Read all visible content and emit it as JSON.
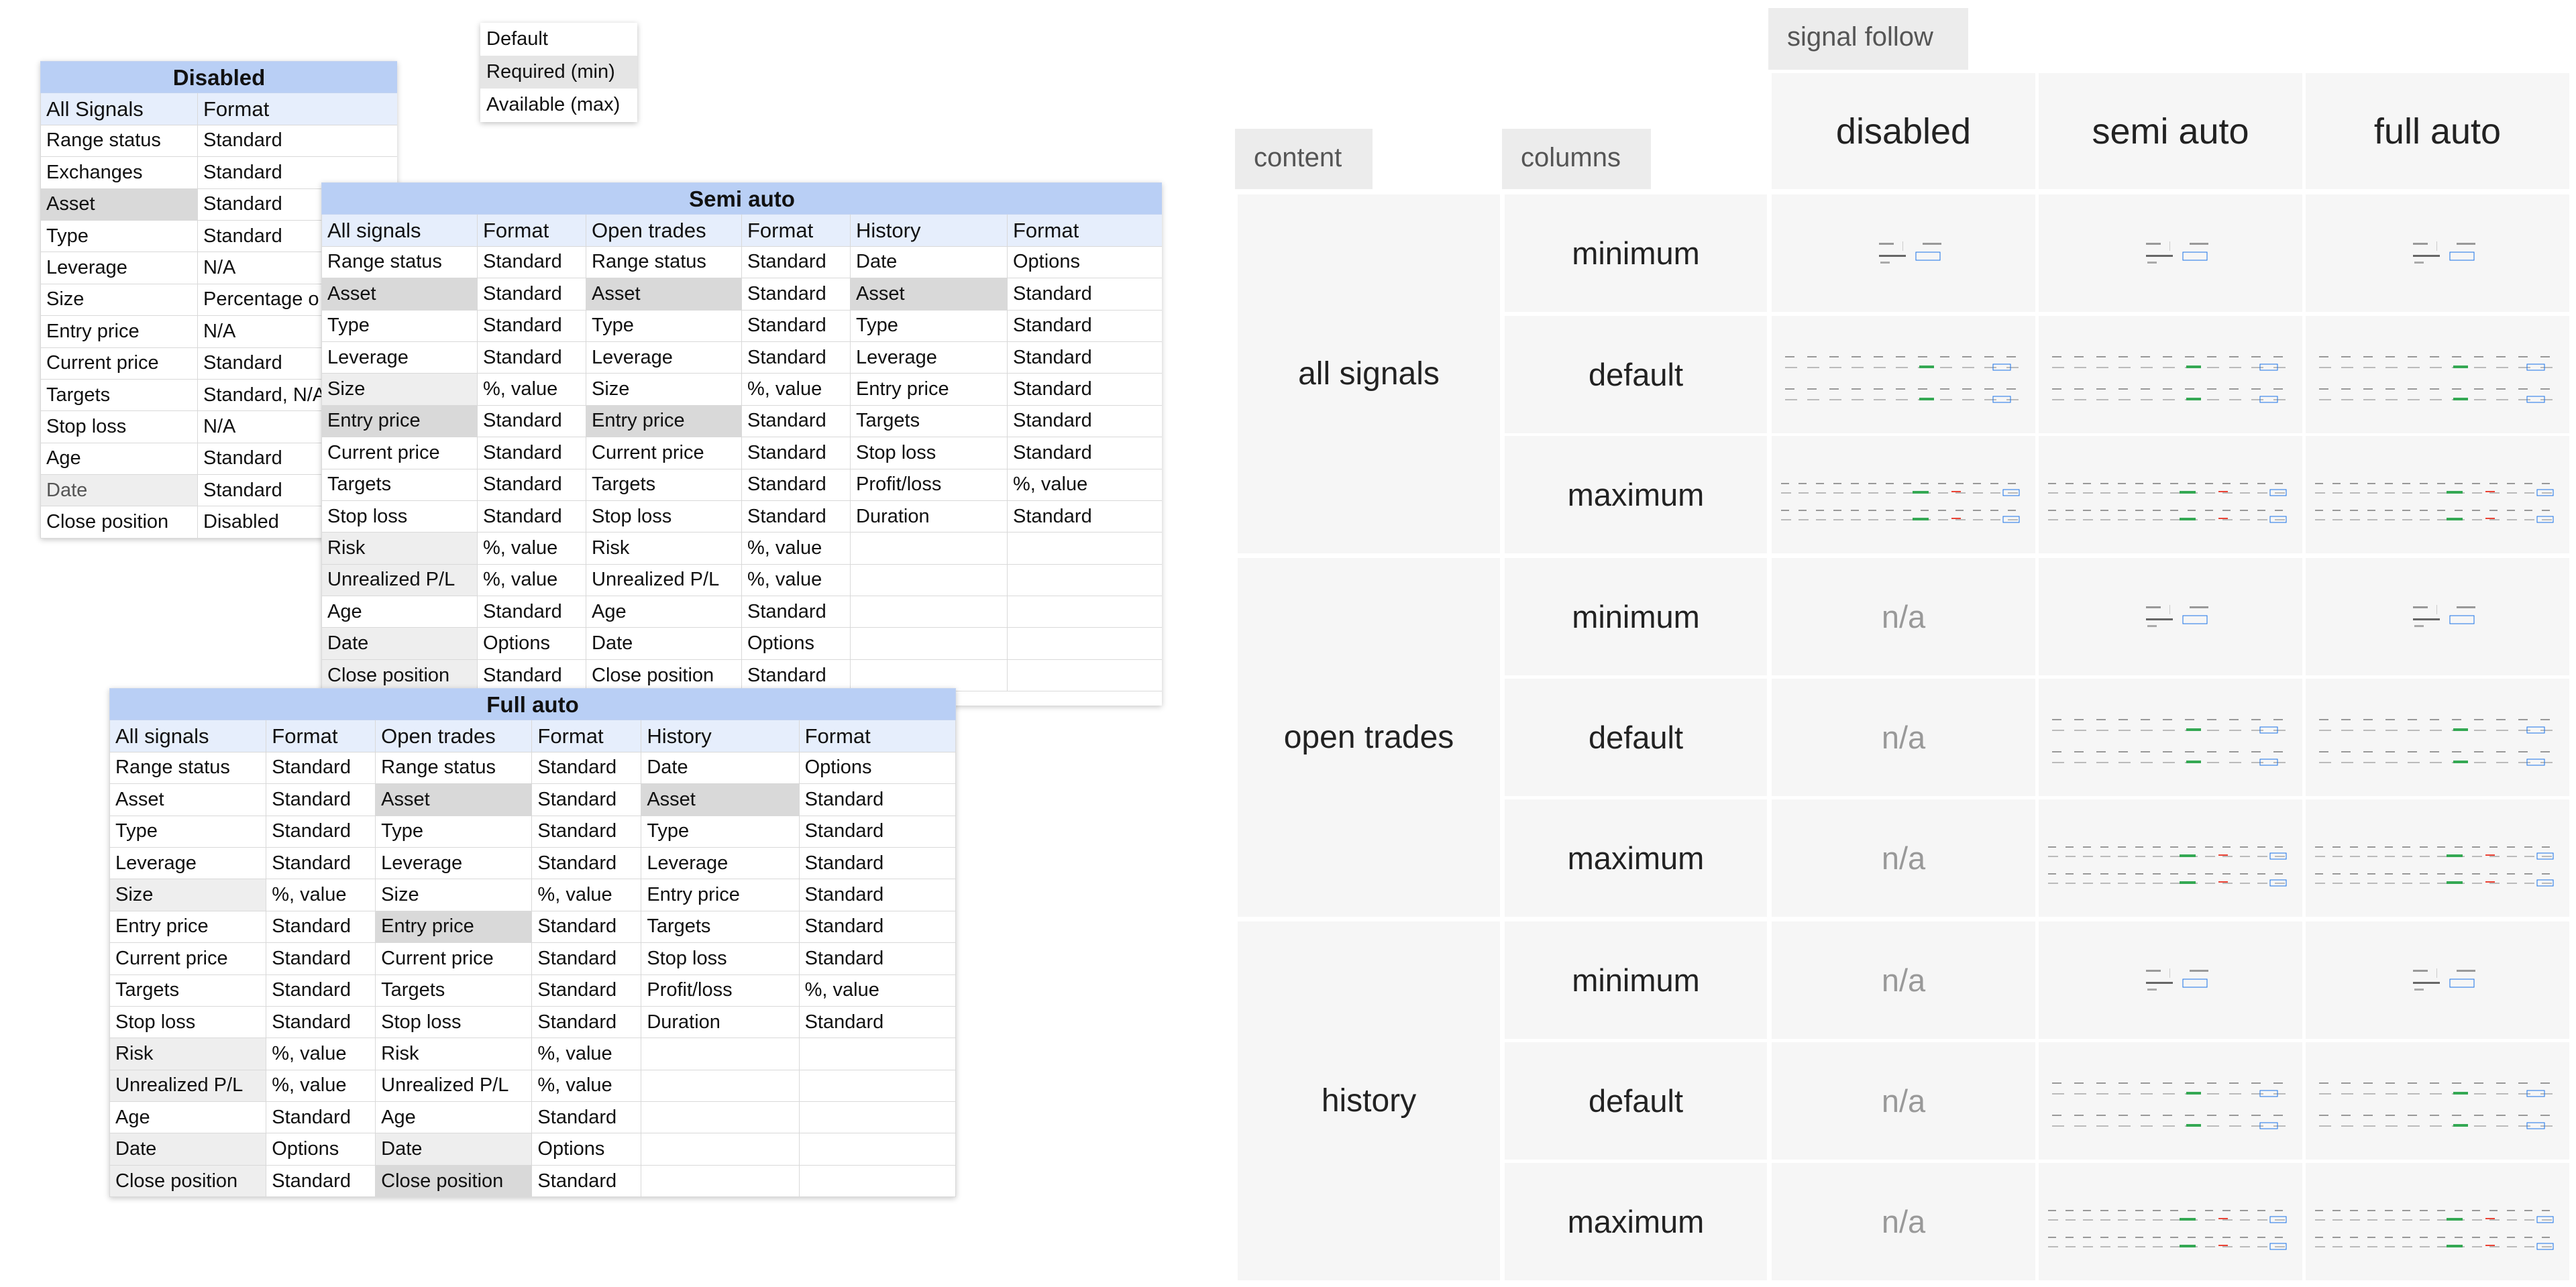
{
  "legend": {
    "items": [
      "Default",
      "Required (min)",
      "Available (max)"
    ]
  },
  "tables": {
    "disabled": {
      "title": "Disabled",
      "headers": [
        "All Signals",
        "Format"
      ],
      "rows": [
        [
          "Range status",
          "Standard"
        ],
        [
          "Exchanges",
          "Standard"
        ],
        [
          "Asset",
          "Standard"
        ],
        [
          "Type",
          "Standard"
        ],
        [
          "Leverage",
          "N/A"
        ],
        [
          "Size",
          "Percentage o"
        ],
        [
          "Entry price",
          "N/A"
        ],
        [
          "Current price",
          "Standard"
        ],
        [
          "Targets",
          "Standard, N/A"
        ],
        [
          "Stop loss",
          "N/A"
        ],
        [
          "Age",
          "Standard"
        ],
        [
          "Date",
          "Standard"
        ],
        [
          "Close position",
          "Disabled"
        ]
      ]
    },
    "semi": {
      "title": "Semi auto",
      "headers": [
        "All signals",
        "Format",
        "Open trades",
        "Format",
        "History",
        "Format"
      ],
      "rows": [
        [
          "Range status",
          "Standard",
          "Range status",
          "Standard",
          "Date",
          "Options"
        ],
        [
          "Asset",
          "Standard",
          "Asset",
          "Standard",
          "Asset",
          "Standard"
        ],
        [
          "Type",
          "Standard",
          "Type",
          "Standard",
          "Type",
          "Standard"
        ],
        [
          "Leverage",
          "Standard",
          "Leverage",
          "Standard",
          "Leverage",
          "Standard"
        ],
        [
          "Size",
          "%, value",
          "Size",
          "%, value",
          "Entry price",
          "Standard"
        ],
        [
          "Entry price",
          "Standard",
          "Entry price",
          "Standard",
          "Targets",
          "Standard"
        ],
        [
          "Current price",
          "Standard",
          "Current price",
          "Standard",
          "Stop loss",
          "Standard"
        ],
        [
          "Targets",
          "Standard",
          "Targets",
          "Standard",
          "Profit/loss",
          "%, value"
        ],
        [
          "Stop loss",
          "Standard",
          "Stop loss",
          "Standard",
          "Duration",
          "Standard"
        ],
        [
          "Risk",
          "%, value",
          "Risk",
          "%, value",
          "",
          ""
        ],
        [
          "Unrealized P/L",
          "%, value",
          "Unrealized P/L",
          "%, value",
          "",
          ""
        ],
        [
          "Age",
          "Standard",
          "Age",
          "Standard",
          "",
          ""
        ],
        [
          "Date",
          "Options",
          "Date",
          "Options",
          "",
          ""
        ],
        [
          "Close position",
          "Standard",
          "Close position",
          "Standard",
          "",
          ""
        ]
      ]
    },
    "full": {
      "title": "Full auto",
      "headers": [
        "All signals",
        "Format",
        "Open trades",
        "Format",
        "History",
        "Format"
      ],
      "rows": [
        [
          "Range status",
          "Standard",
          "Range status",
          "Standard",
          "Date",
          "Options"
        ],
        [
          "Asset",
          "Standard",
          "Asset",
          "Standard",
          "Asset",
          "Standard"
        ],
        [
          "Type",
          "Standard",
          "Type",
          "Standard",
          "Type",
          "Standard"
        ],
        [
          "Leverage",
          "Standard",
          "Leverage",
          "Standard",
          "Leverage",
          "Standard"
        ],
        [
          "Size",
          "%, value",
          "Size",
          "%, value",
          "Entry price",
          "Standard"
        ],
        [
          "Entry price",
          "Standard",
          "Entry price",
          "Standard",
          "Targets",
          "Standard"
        ],
        [
          "Current price",
          "Standard",
          "Current price",
          "Standard",
          "Stop loss",
          "Standard"
        ],
        [
          "Targets",
          "Standard",
          "Targets",
          "Standard",
          "Profit/loss",
          "%, value"
        ],
        [
          "Stop loss",
          "Standard",
          "Stop loss",
          "Standard",
          "Duration",
          "Standard"
        ],
        [
          "Risk",
          "%, value",
          "Risk",
          "%, value",
          "",
          ""
        ],
        [
          "Unrealized P/L",
          "%, value",
          "Unrealized P/L",
          "%, value",
          "",
          ""
        ],
        [
          "Age",
          "Standard",
          "Age",
          "Standard",
          "",
          ""
        ],
        [
          "Date",
          "Options",
          "Date",
          "Options",
          "",
          ""
        ],
        [
          "Close position",
          "Standard",
          "Close position",
          "Standard",
          "",
          ""
        ]
      ]
    }
  },
  "matrix": {
    "tab_signal_follow": "signal follow",
    "tab_content": "content",
    "tab_columns": "columns",
    "modes": [
      "disabled",
      "semi auto",
      "full auto"
    ],
    "groups": [
      {
        "label": "all signals",
        "rows": [
          {
            "column": "minimum",
            "cells": [
              "thumb-min",
              "thumb-min",
              "thumb-min"
            ]
          },
          {
            "column": "default",
            "cells": [
              "thumb-default",
              "thumb-default",
              "thumb-default"
            ]
          },
          {
            "column": "maximum",
            "cells": [
              "thumb-max",
              "thumb-max",
              "thumb-max"
            ]
          }
        ]
      },
      {
        "label": "open trades",
        "rows": [
          {
            "column": "minimum",
            "cells": [
              "n/a",
              "thumb-min",
              "thumb-min"
            ]
          },
          {
            "column": "default",
            "cells": [
              "n/a",
              "thumb-default",
              "thumb-default"
            ]
          },
          {
            "column": "maximum",
            "cells": [
              "n/a",
              "thumb-max",
              "thumb-max"
            ]
          }
        ]
      },
      {
        "label": "history",
        "rows": [
          {
            "column": "minimum",
            "cells": [
              "n/a",
              "thumb-min",
              "thumb-min"
            ]
          },
          {
            "column": "default",
            "cells": [
              "n/a",
              "thumb-default",
              "thumb-default"
            ]
          },
          {
            "column": "maximum",
            "cells": [
              "n/a",
              "thumb-max",
              "thumb-max"
            ]
          }
        ]
      }
    ]
  },
  "colors": {
    "accent": "#1a73e8",
    "positive": "#34a853",
    "negative": "#ea4335"
  }
}
